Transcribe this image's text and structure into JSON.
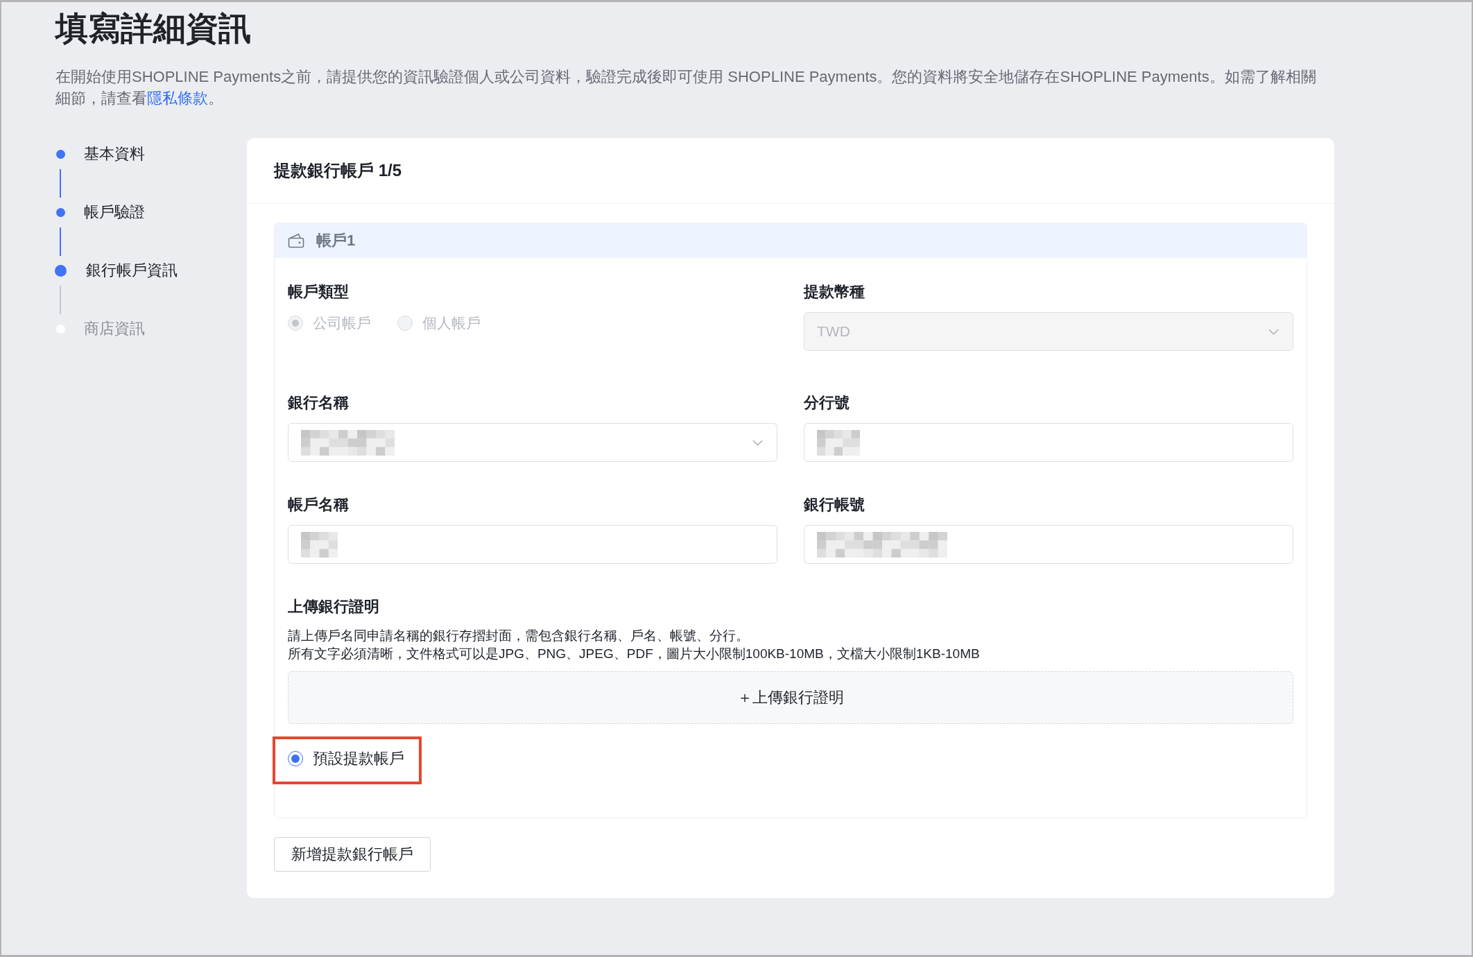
{
  "page": {
    "title": "填寫詳細資訊",
    "description": {
      "text": "在開始使用SHOPLINE Payments之前，請提供您的資訊驗證個人或公司資料，驗證完成後即可使用 SHOPLINE Payments。您的資料將安全地儲存在SHOPLINE Payments。如需了解相關細節，請查看",
      "link": "隱私條款",
      "after": "。"
    }
  },
  "steps": [
    {
      "label": "基本資料",
      "completed": true,
      "selected": false
    },
    {
      "label": "帳戶驗證",
      "completed": true,
      "selected": false
    },
    {
      "label": "銀行帳戶資訊",
      "completed": false,
      "selected": true
    },
    {
      "label": "商店資訊",
      "completed": false,
      "selected": false
    }
  ],
  "card": {
    "title": "提款銀行帳戶 1/5",
    "account": {
      "title": "帳戶1",
      "fields": [
        {
          "kind": "radio_group",
          "label": "帳戶類型",
          "disabled": true,
          "options": [
            {
              "label": "公司帳戶",
              "selected": true
            },
            {
              "label": "個人帳戶",
              "selected": false
            }
          ]
        },
        {
          "kind": "select",
          "label": "提款幣種",
          "value": "TWD",
          "disabled": true,
          "redacted": false
        },
        {
          "kind": "select",
          "label": "銀行名稱",
          "disabled": false,
          "redacted": true
        },
        {
          "kind": "input",
          "label": "分行號",
          "disabled": false,
          "redacted": true
        },
        {
          "kind": "input",
          "label": "帳戶名稱",
          "disabled": false,
          "redacted": true
        },
        {
          "kind": "input",
          "label": "銀行帳號",
          "disabled": false,
          "redacted": true
        }
      ],
      "upload": {
        "label": "上傳銀行證明",
        "help": [
          "請上傳戶名同申請名稱的銀行存摺封面，需包含銀行名稱、戶名、帳號、分行。",
          "所有文字必須清晰，文件格式可以是JPG、PNG、JPEG、PDF，圖片大小限制100KB-10MB，文檔大小限制1KB-10MB"
        ],
        "button": "＋上傳銀行證明"
      },
      "default_account": {
        "label": "預設提款帳戶",
        "checked": true,
        "highlighted": true
      }
    },
    "add_button": "新增提款銀行帳戶"
  }
}
